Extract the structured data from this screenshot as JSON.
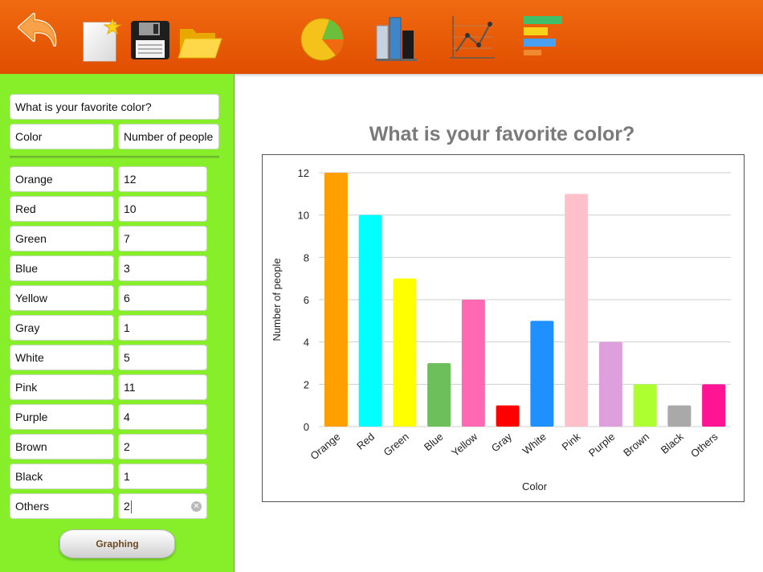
{
  "toolbar": {
    "buttons": [
      {
        "name": "back-button",
        "icon": "undo-arrow-icon"
      },
      {
        "name": "new-button",
        "icon": "new-document-icon"
      },
      {
        "name": "save-button",
        "icon": "floppy-disk-icon"
      },
      {
        "name": "open-button",
        "icon": "folder-icon"
      },
      {
        "name": "pie-chart-button",
        "icon": "pie-chart-icon"
      },
      {
        "name": "bar-chart-button",
        "icon": "bar-chart-icon"
      },
      {
        "name": "line-chart-button",
        "icon": "line-chart-icon"
      },
      {
        "name": "horizontal-bar-button",
        "icon": "horizontal-bar-chart-icon"
      }
    ],
    "color": "#e85a05"
  },
  "form": {
    "title_value": "What is your favorite color?",
    "col1_header": "Color",
    "col2_header": "Number of people",
    "rows": [
      {
        "label": "Orange",
        "value": "12"
      },
      {
        "label": "Red",
        "value": "10"
      },
      {
        "label": "Green",
        "value": "7"
      },
      {
        "label": "Blue",
        "value": "3"
      },
      {
        "label": "Yellow",
        "value": "6"
      },
      {
        "label": "Gray",
        "value": "1"
      },
      {
        "label": "White",
        "value": "5"
      },
      {
        "label": "Pink",
        "value": "11"
      },
      {
        "label": "Purple",
        "value": "4"
      },
      {
        "label": "Brown",
        "value": "2"
      },
      {
        "label": "Black",
        "value": "1"
      },
      {
        "label": "Others",
        "value": "2"
      }
    ],
    "graph_button": "Graphing",
    "sidebar_color": "#86ef2a"
  },
  "chart_data": {
    "type": "bar",
    "title": "What is your favorite color?",
    "xlabel": "Color",
    "ylabel": "Number of people",
    "categories": [
      "Orange",
      "Red",
      "Green",
      "Blue",
      "Yellow",
      "Gray",
      "White",
      "Pink",
      "Purple",
      "Brown",
      "Black",
      "Others"
    ],
    "values": [
      12,
      10,
      7,
      3,
      6,
      1,
      5,
      11,
      4,
      2,
      1,
      2
    ],
    "colors": [
      "#ff9f00",
      "#00ffff",
      "#ffff00",
      "#6cbf5a",
      "#ff69b4",
      "#ff0000",
      "#1e90ff",
      "#ffc0cb",
      "#dda0dd",
      "#adff2f",
      "#a9a9a9",
      "#ff1493"
    ],
    "ylim": [
      0,
      12
    ],
    "yticks": [
      0,
      2,
      4,
      6,
      8,
      10,
      12
    ],
    "grid": true,
    "legend": "none"
  }
}
